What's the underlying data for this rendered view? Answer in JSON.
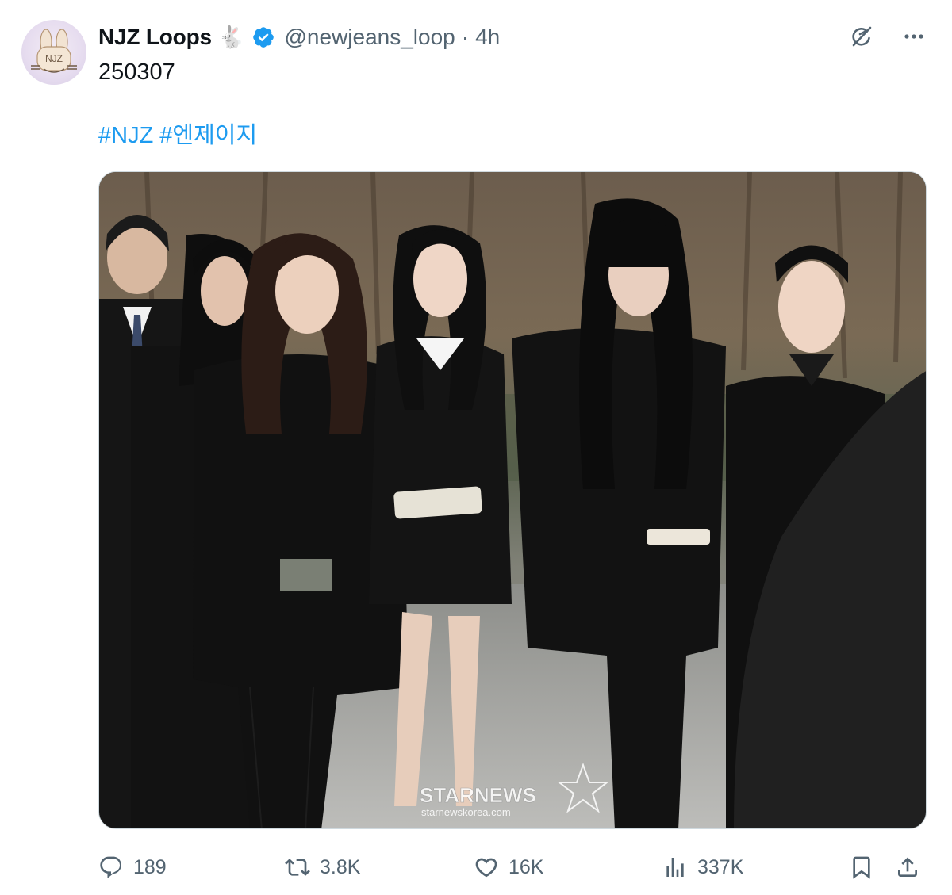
{
  "author": {
    "name": "NJZ Loops",
    "emoji": "🐇",
    "handle": "@newjeans_loop",
    "separator": "·",
    "time": "4h",
    "avatar_text": "NJZ"
  },
  "tweet": {
    "text": "250307",
    "hashtags": [
      "#NJZ",
      "#엔제이지"
    ]
  },
  "media": {
    "watermark_brand": "STARNEWS",
    "watermark_url": "starnewskorea.com"
  },
  "actions": {
    "reply_count": "189",
    "retweet_count": "3.8K",
    "like_count": "16K",
    "view_count": "337K"
  },
  "colors": {
    "link": "#1d9bf0",
    "secondary_text": "#536471",
    "verified": "#1d9bf0"
  },
  "icons": [
    "verified-icon",
    "grok-icon",
    "more-icon",
    "reply-icon",
    "retweet-icon",
    "like-icon",
    "views-icon",
    "bookmark-icon",
    "share-icon"
  ]
}
